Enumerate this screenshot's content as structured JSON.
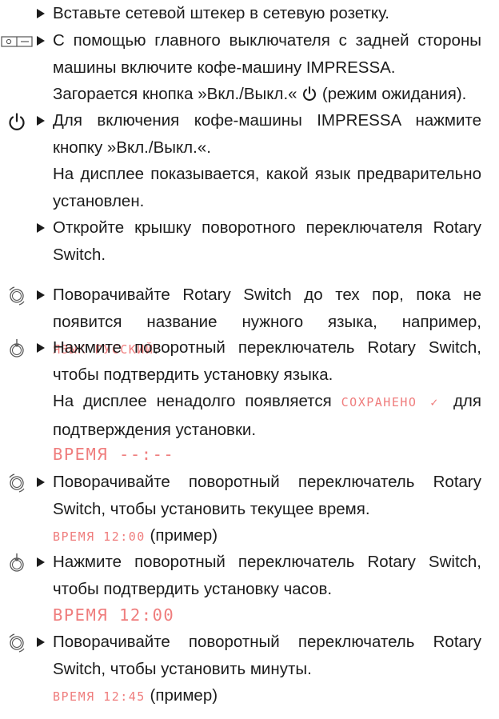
{
  "steps": [
    {
      "text": "Вставьте сетевой штекер в сетевую розетку."
    },
    {
      "text": "С помощью главного выключателя с задней стороны машины включите кофе-машину IMPRESSA.",
      "note_before": "Загорается кнопка »Вкл./Выкл.« ",
      "note_after": " (режим ожидания)."
    },
    {
      "text": "Для включения кофе-машины IMPRESSA нажмите кнопку »Вкл./Выкл.«.",
      "note": "На дисплее показывается, какой язык предварительно установлен."
    },
    {
      "text": "Откройте крышку поворотного переключателя Rotary Switch."
    },
    {
      "text_before": "Поворачивайте Rotary Switch до тех пор, пока не появится название нужного языка, например, ",
      "lcd": "ЯЗЫК РУССКИЙ",
      "text_after": "."
    },
    {
      "text": "Нажмите поворотный переключатель Rotary Switch, чтобы подтвердить установку языка.",
      "note_before": "На дисплее ненадолго появляется ",
      "note_lcd": "СОХРАНЕНО ✓",
      "note_after": " для подтверждения установки.",
      "lcd_line": "ВРЕМЯ --:--"
    },
    {
      "text": "Поворачивайте поворотный переключатель Rotary Switch, чтобы установить текущее время.",
      "lcd": "ВРЕМЯ 12:00",
      "suffix": " (пример)"
    },
    {
      "text": "Нажмите поворотный переключатель Rotary Switch, чтобы подтвердить установку часов.",
      "lcd": "ВРЕМЯ 12:00"
    },
    {
      "text": "Поворачивайте поворотный переключатель Rotary Switch, чтобы установить минуты.",
      "lcd": "ВРЕМЯ 12:45",
      "suffix": " (пример)"
    }
  ],
  "colors": {
    "text": "#1c1c1c",
    "display": "#ef7d7d",
    "icon": "#555555"
  },
  "icons": [
    "main-switch-icon",
    "power-icon",
    "rotary-turn-icon",
    "rotary-press-icon"
  ]
}
